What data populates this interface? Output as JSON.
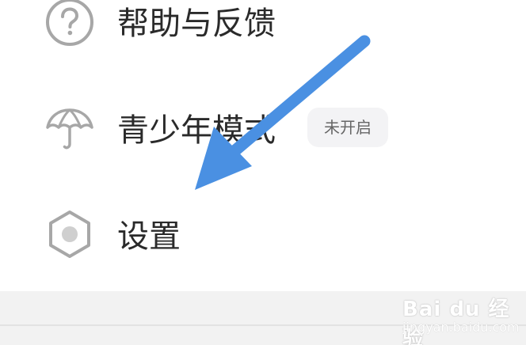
{
  "menu": {
    "items": [
      {
        "label": "帮助与反馈",
        "icon": "question-circle-icon"
      },
      {
        "label": "青少年模式",
        "icon": "umbrella-icon",
        "badge": "未开启"
      },
      {
        "label": "设置",
        "icon": "hexagon-settings-icon"
      }
    ]
  },
  "annotation": {
    "arrow_color": "#4a90e2"
  },
  "watermark": {
    "brand": "Bai du 经验",
    "sub": "jingyan.baidu.com"
  }
}
